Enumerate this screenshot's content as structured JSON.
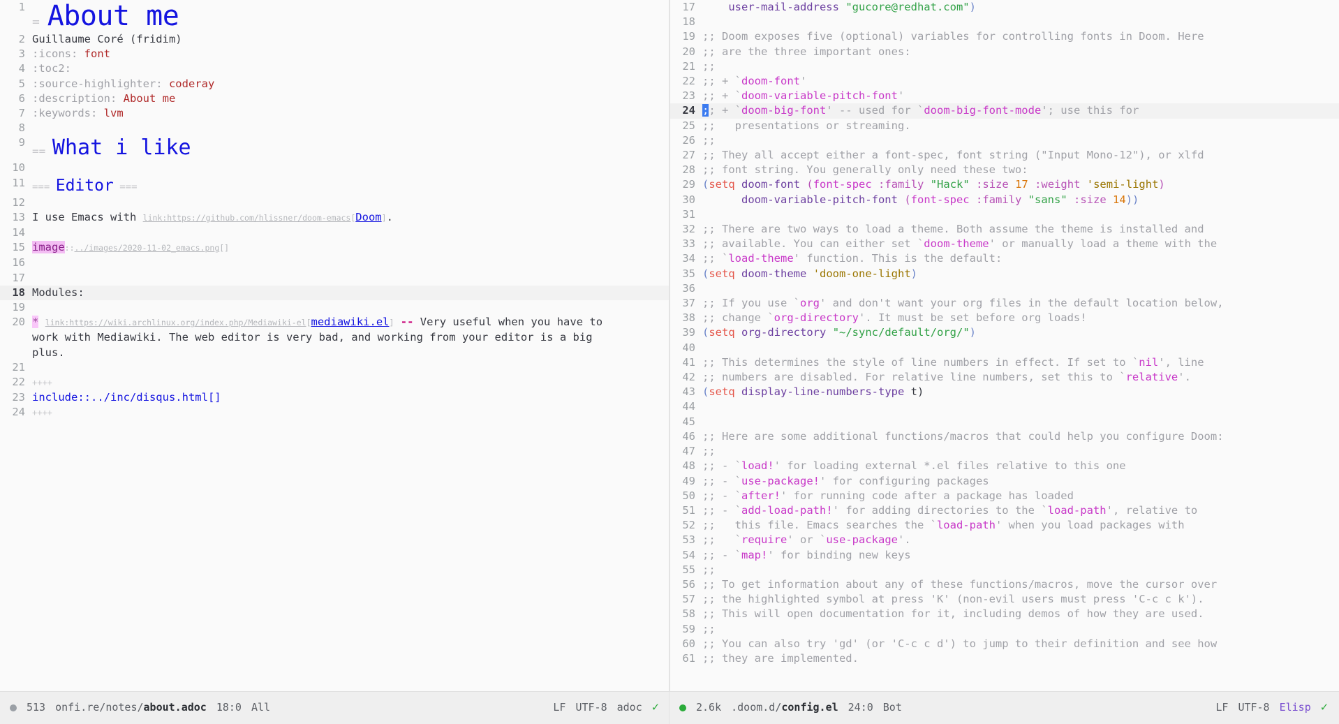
{
  "app": {
    "name": "Emacs",
    "theme": "doom-one-light"
  },
  "left_pane": {
    "buffer_name": "about.adoc",
    "lines": [
      {
        "n": "1",
        "kind": "h1",
        "marker": "=",
        "text": "About me"
      },
      {
        "n": "2",
        "kind": "plain",
        "text": "Guillaume Coré (fridim)"
      },
      {
        "n": "3",
        "kind": "attr",
        "name": ":icons:",
        "value": "font"
      },
      {
        "n": "4",
        "kind": "attr",
        "name": ":toc2:",
        "value": ""
      },
      {
        "n": "5",
        "kind": "attr",
        "name": ":source-highlighter:",
        "value": "coderay"
      },
      {
        "n": "6",
        "kind": "attr",
        "name": ":description:",
        "value": "About me"
      },
      {
        "n": "7",
        "kind": "attr",
        "name": ":keywords:",
        "value": "lvm"
      },
      {
        "n": "8",
        "kind": "blank",
        "text": ""
      },
      {
        "n": "9",
        "kind": "h2",
        "marker": "==",
        "text": "What i like"
      },
      {
        "n": "10",
        "kind": "blank",
        "text": ""
      },
      {
        "n": "11",
        "kind": "h3",
        "marker": "===",
        "text": "Editor",
        "trailer": "==="
      },
      {
        "n": "12",
        "kind": "blank",
        "text": ""
      },
      {
        "n": "13",
        "kind": "link_line",
        "pre": "I use Emacs with ",
        "url": "link:https://github.com/hlissner/doom-emacs",
        "open": "[",
        "label": "Doom",
        "close": "]",
        "post": "."
      },
      {
        "n": "14",
        "kind": "blank",
        "text": ""
      },
      {
        "n": "15",
        "kind": "image_line",
        "macro": "image",
        "sep": "::",
        "path": "../images/2020-11-02_emacs.png",
        "brackets": "[]"
      },
      {
        "n": "16",
        "kind": "blank",
        "text": ""
      },
      {
        "n": "17",
        "kind": "blank",
        "text": ""
      },
      {
        "n": "18",
        "kind": "plain",
        "text": "Modules:",
        "current": true
      },
      {
        "n": "19",
        "kind": "blank",
        "text": ""
      },
      {
        "n": "20",
        "kind": "bullet_link",
        "bullet": "*",
        "url": "link:https://wiki.archlinux.org/index.php/Mediawiki-el",
        "open": "[",
        "label": "mediawiki.el",
        "close": "]",
        "dashes": " -- ",
        "rest": "Very useful when you have to",
        "cont": "work with Mediawiki. The web editor is very bad, and working from your editor is a big\nplus."
      },
      {
        "n": "21",
        "kind": "blank",
        "text": ""
      },
      {
        "n": "22",
        "kind": "delim",
        "text": "++++"
      },
      {
        "n": "23",
        "kind": "include",
        "text": "include::../inc/disqus.html[]"
      },
      {
        "n": "24",
        "kind": "delim",
        "text": "++++"
      }
    ]
  },
  "right_pane": {
    "buffer_name": "config.el",
    "lines": [
      {
        "n": "17",
        "segs": [
          {
            "t": "    ",
            "c": "plain"
          },
          {
            "t": "user-mail-address",
            "c": "var"
          },
          {
            "t": " ",
            "c": "plain"
          },
          {
            "t": "\"gucore@redhat.com\"",
            "c": "str"
          },
          {
            "t": ")",
            "c": "paren"
          }
        ]
      },
      {
        "n": "18",
        "segs": []
      },
      {
        "n": "19",
        "segs": [
          {
            "t": ";; Doom exposes five (optional) variables for controlling fonts in Doom. Here",
            "c": "cmt"
          }
        ]
      },
      {
        "n": "20",
        "segs": [
          {
            "t": ";; are the three important ones:",
            "c": "cmt"
          }
        ]
      },
      {
        "n": "21",
        "segs": [
          {
            "t": ";;",
            "c": "cmt"
          }
        ]
      },
      {
        "n": "22",
        "segs": [
          {
            "t": ";; + `",
            "c": "cmt"
          },
          {
            "t": "doom-font",
            "c": "sym-quote"
          },
          {
            "t": "'",
            "c": "cmt"
          }
        ]
      },
      {
        "n": "23",
        "segs": [
          {
            "t": ";; + `",
            "c": "cmt"
          },
          {
            "t": "doom-variable-pitch-font",
            "c": "sym-quote"
          },
          {
            "t": "'",
            "c": "cmt"
          }
        ]
      },
      {
        "n": "24",
        "current": true,
        "cursor_col": 0,
        "segs": [
          {
            "t": ";",
            "c": "cursor"
          },
          {
            "t": "; + `",
            "c": "cmt"
          },
          {
            "t": "doom-big-font",
            "c": "sym-quote"
          },
          {
            "t": "' -- used for `",
            "c": "cmt"
          },
          {
            "t": "doom-big-font-mode",
            "c": "sym-quote"
          },
          {
            "t": "'; use this for",
            "c": "cmt"
          }
        ]
      },
      {
        "n": "25",
        "segs": [
          {
            "t": ";;   presentations or streaming.",
            "c": "cmt"
          }
        ]
      },
      {
        "n": "26",
        "segs": [
          {
            "t": ";;",
            "c": "cmt"
          }
        ]
      },
      {
        "n": "27",
        "segs": [
          {
            "t": ";; They all accept either a font-spec, font string (\"Input Mono-12\"), or xlfd",
            "c": "cmt"
          }
        ]
      },
      {
        "n": "28",
        "segs": [
          {
            "t": ";; font string. You generally only need these two:",
            "c": "cmt"
          }
        ]
      },
      {
        "n": "29",
        "segs": [
          {
            "t": "(",
            "c": "paren"
          },
          {
            "t": "setq",
            "c": "builtin"
          },
          {
            "t": " ",
            "c": "plain"
          },
          {
            "t": "doom-font",
            "c": "var"
          },
          {
            "t": " ",
            "c": "plain"
          },
          {
            "t": "(",
            "c": "paren2"
          },
          {
            "t": "font-spec",
            "c": "fn"
          },
          {
            "t": " ",
            "c": "plain"
          },
          {
            "t": ":family",
            "c": "kw"
          },
          {
            "t": " ",
            "c": "plain"
          },
          {
            "t": "\"Hack\"",
            "c": "str"
          },
          {
            "t": " ",
            "c": "plain"
          },
          {
            "t": ":size",
            "c": "kw"
          },
          {
            "t": " ",
            "c": "plain"
          },
          {
            "t": "17",
            "c": "num"
          },
          {
            "t": " ",
            "c": "plain"
          },
          {
            "t": ":weight",
            "c": "kw"
          },
          {
            "t": " ",
            "c": "plain"
          },
          {
            "t": "'semi-light",
            "c": "quoted"
          },
          {
            "t": ")",
            "c": "paren2"
          }
        ]
      },
      {
        "n": "30",
        "segs": [
          {
            "t": "      ",
            "c": "plain"
          },
          {
            "t": "doom-variable-pitch-font",
            "c": "var"
          },
          {
            "t": " ",
            "c": "plain"
          },
          {
            "t": "(",
            "c": "paren2"
          },
          {
            "t": "font-spec",
            "c": "fn"
          },
          {
            "t": " ",
            "c": "plain"
          },
          {
            "t": ":family",
            "c": "kw"
          },
          {
            "t": " ",
            "c": "plain"
          },
          {
            "t": "\"sans\"",
            "c": "str"
          },
          {
            "t": " ",
            "c": "plain"
          },
          {
            "t": ":size",
            "c": "kw"
          },
          {
            "t": " ",
            "c": "plain"
          },
          {
            "t": "14",
            "c": "num"
          },
          {
            "t": "))",
            "c": "paren"
          }
        ]
      },
      {
        "n": "31",
        "segs": []
      },
      {
        "n": "32",
        "segs": [
          {
            "t": ";; There are two ways to load a theme. Both assume the theme is installed and",
            "c": "cmt"
          }
        ]
      },
      {
        "n": "33",
        "segs": [
          {
            "t": ";; available. You can either set `",
            "c": "cmt"
          },
          {
            "t": "doom-theme",
            "c": "sym-quote"
          },
          {
            "t": "' or manually load a theme with the",
            "c": "cmt"
          }
        ]
      },
      {
        "n": "34",
        "segs": [
          {
            "t": ";; `",
            "c": "cmt"
          },
          {
            "t": "load-theme",
            "c": "sym-quote"
          },
          {
            "t": "' function. This is the default:",
            "c": "cmt"
          }
        ]
      },
      {
        "n": "35",
        "segs": [
          {
            "t": "(",
            "c": "paren"
          },
          {
            "t": "setq",
            "c": "builtin"
          },
          {
            "t": " ",
            "c": "plain"
          },
          {
            "t": "doom-theme",
            "c": "var"
          },
          {
            "t": " ",
            "c": "plain"
          },
          {
            "t": "'doom-one-light",
            "c": "quoted"
          },
          {
            "t": ")",
            "c": "paren"
          }
        ]
      },
      {
        "n": "36",
        "segs": []
      },
      {
        "n": "37",
        "segs": [
          {
            "t": ";; If you use `",
            "c": "cmt"
          },
          {
            "t": "org",
            "c": "sym-quote"
          },
          {
            "t": "' and don't want your org files in the default location below,",
            "c": "cmt"
          }
        ]
      },
      {
        "n": "38",
        "segs": [
          {
            "t": ";; change `",
            "c": "cmt"
          },
          {
            "t": "org-directory",
            "c": "sym-quote"
          },
          {
            "t": "'. It must be set before org loads!",
            "c": "cmt"
          }
        ]
      },
      {
        "n": "39",
        "segs": [
          {
            "t": "(",
            "c": "paren"
          },
          {
            "t": "setq",
            "c": "builtin"
          },
          {
            "t": " ",
            "c": "plain"
          },
          {
            "t": "org-directory",
            "c": "var"
          },
          {
            "t": " ",
            "c": "plain"
          },
          {
            "t": "\"~/sync/default/org/\"",
            "c": "str"
          },
          {
            "t": ")",
            "c": "paren"
          }
        ]
      },
      {
        "n": "40",
        "segs": []
      },
      {
        "n": "41",
        "segs": [
          {
            "t": ";; This determines the style of line numbers in effect. If set to `",
            "c": "cmt"
          },
          {
            "t": "nil",
            "c": "sym-quote"
          },
          {
            "t": "', line",
            "c": "cmt"
          }
        ]
      },
      {
        "n": "42",
        "segs": [
          {
            "t": ";; numbers are disabled. For relative line numbers, set this to `",
            "c": "cmt"
          },
          {
            "t": "relative",
            "c": "sym-quote"
          },
          {
            "t": "'.",
            "c": "cmt"
          }
        ]
      },
      {
        "n": "43",
        "segs": [
          {
            "t": "(",
            "c": "paren"
          },
          {
            "t": "setq",
            "c": "builtin"
          },
          {
            "t": " ",
            "c": "plain"
          },
          {
            "t": "display-line-numbers-type",
            "c": "var"
          },
          {
            "t": " t)",
            "c": "plain"
          }
        ]
      },
      {
        "n": "44",
        "segs": []
      },
      {
        "n": "45",
        "segs": []
      },
      {
        "n": "46",
        "segs": [
          {
            "t": ";; Here are some additional functions/macros that could help you configure Doom:",
            "c": "cmt"
          }
        ]
      },
      {
        "n": "47",
        "segs": [
          {
            "t": ";;",
            "c": "cmt"
          }
        ]
      },
      {
        "n": "48",
        "segs": [
          {
            "t": ";; - `",
            "c": "cmt"
          },
          {
            "t": "load!",
            "c": "sym-quote"
          },
          {
            "t": "' for loading external *.el files relative to this one",
            "c": "cmt"
          }
        ]
      },
      {
        "n": "49",
        "segs": [
          {
            "t": ";; - `",
            "c": "cmt"
          },
          {
            "t": "use-package!",
            "c": "sym-quote"
          },
          {
            "t": "' for configuring packages",
            "c": "cmt"
          }
        ]
      },
      {
        "n": "50",
        "segs": [
          {
            "t": ";; - `",
            "c": "cmt"
          },
          {
            "t": "after!",
            "c": "sym-quote"
          },
          {
            "t": "' for running code after a package has loaded",
            "c": "cmt"
          }
        ]
      },
      {
        "n": "51",
        "segs": [
          {
            "t": ";; - `",
            "c": "cmt"
          },
          {
            "t": "add-load-path!",
            "c": "sym-quote"
          },
          {
            "t": "' for adding directories to the `",
            "c": "cmt"
          },
          {
            "t": "load-path",
            "c": "sym-quote"
          },
          {
            "t": "', relative to",
            "c": "cmt"
          }
        ]
      },
      {
        "n": "52",
        "segs": [
          {
            "t": ";;   this file. Emacs searches the `",
            "c": "cmt"
          },
          {
            "t": "load-path",
            "c": "sym-quote"
          },
          {
            "t": "' when you load packages with",
            "c": "cmt"
          }
        ]
      },
      {
        "n": "53",
        "segs": [
          {
            "t": ";;   `",
            "c": "cmt"
          },
          {
            "t": "require",
            "c": "sym-quote"
          },
          {
            "t": "' or `",
            "c": "cmt"
          },
          {
            "t": "use-package",
            "c": "sym-quote"
          },
          {
            "t": "'.",
            "c": "cmt"
          }
        ]
      },
      {
        "n": "54",
        "segs": [
          {
            "t": ";; - `",
            "c": "cmt"
          },
          {
            "t": "map!",
            "c": "sym-quote"
          },
          {
            "t": "' for binding new keys",
            "c": "cmt"
          }
        ]
      },
      {
        "n": "55",
        "segs": [
          {
            "t": ";;",
            "c": "cmt"
          }
        ]
      },
      {
        "n": "56",
        "segs": [
          {
            "t": ";; To get information about any of these functions/macros, move the cursor over",
            "c": "cmt"
          }
        ]
      },
      {
        "n": "57",
        "segs": [
          {
            "t": ";; the highlighted symbol at press 'K' (non-evil users must press 'C-c c k').",
            "c": "cmt"
          }
        ]
      },
      {
        "n": "58",
        "segs": [
          {
            "t": ";; This will open documentation for it, including demos of how they are used.",
            "c": "cmt"
          }
        ]
      },
      {
        "n": "59",
        "segs": [
          {
            "t": ";;",
            "c": "cmt"
          }
        ]
      },
      {
        "n": "60",
        "segs": [
          {
            "t": ";; You can also try 'gd' (or 'C-c c d') to jump to their definition and see how",
            "c": "cmt"
          }
        ]
      },
      {
        "n": "61",
        "segs": [
          {
            "t": ";; they are implemented.",
            "c": "cmt"
          }
        ]
      }
    ]
  },
  "modeline": {
    "left": {
      "indicator": "●",
      "size": "513",
      "path_dir": "onfi.re/notes/",
      "path_file": "about.adoc",
      "position": "18:0",
      "scroll": "All",
      "eol": "LF",
      "encoding": "UTF-8",
      "major_mode": "adoc",
      "check": "✓"
    },
    "right": {
      "indicator": "●",
      "size": "2.6k",
      "path_dir": ".doom.d/",
      "path_file": "config.el",
      "position": "24:0",
      "scroll": "Bot",
      "eol": "LF",
      "encoding": "UTF-8",
      "major_mode": "Elisp",
      "check": "✓"
    }
  },
  "colors": {
    "bg": "#fafafa",
    "fg": "#383a42",
    "line_number": "#9ca0a4",
    "heading": "#1414e0",
    "comment": "#a0a1a7",
    "string": "#31a146",
    "keyword": "#b751b6",
    "builtin": "#e4564a",
    "variable": "#6c3fa0",
    "number": "#d9760a",
    "quoted": "#9a7500",
    "cursor": "#3b7bf0",
    "modeline_bg": "#efefef",
    "attr_value": "#b02a2a",
    "macro_bg": "#f3bdf3",
    "bullet_bg": "#f9c7f9",
    "elisp_mode": "#7a4fd0"
  }
}
